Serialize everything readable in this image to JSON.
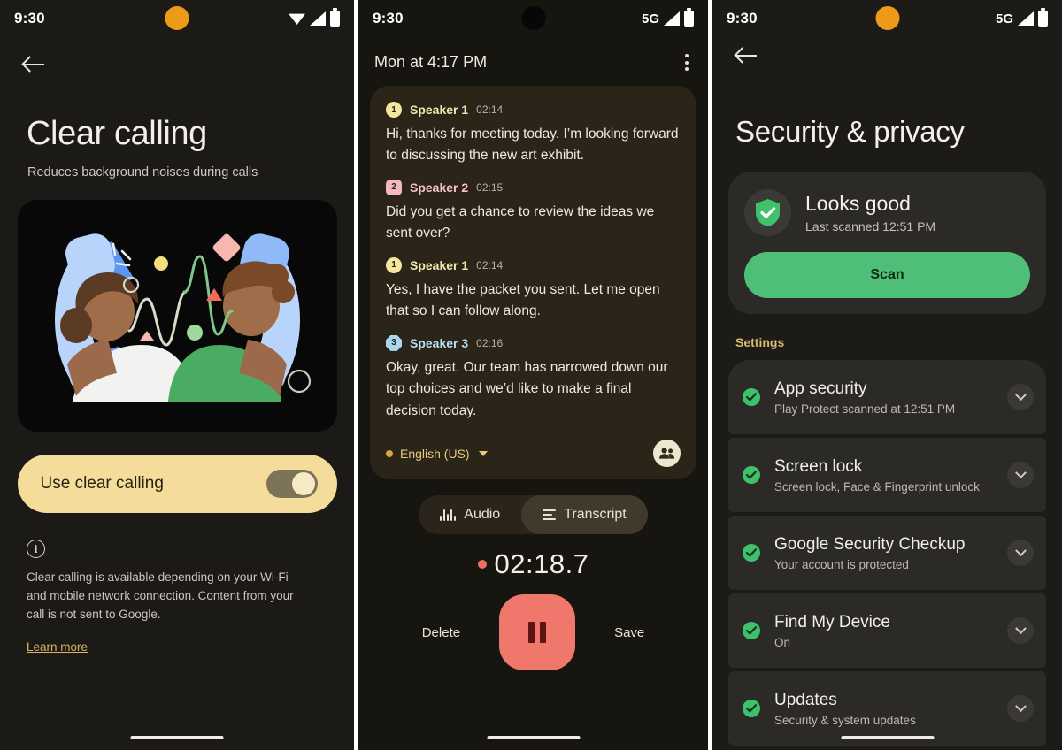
{
  "panel1": {
    "status": {
      "time": "9:30",
      "camera_color": "#ec9a17",
      "icons": [
        "wifi-icon",
        "signal-icon",
        "battery-icon"
      ]
    },
    "back_label": "back-arrow",
    "title": "Clear calling",
    "subtitle": "Reduces background noises during calls",
    "illustration_name": "two-people-call-illustration",
    "toggle": {
      "label": "Use clear calling",
      "state": "on",
      "card_color": "#f4dd9b"
    },
    "info_glyph": "i",
    "note": "Clear calling is available depending on your Wi-Fi and mobile network connection. Content from your call is not sent to Google.",
    "learn_more": "Learn more"
  },
  "panel2": {
    "status": {
      "time": "9:30",
      "camera_color": "#070707",
      "network": "5G",
      "icons": [
        "signal-icon",
        "battery-icon"
      ]
    },
    "header": {
      "date": "Mon at 4:17 PM",
      "menu": "more-options"
    },
    "transcript": [
      {
        "badge": "1",
        "speaker": "Speaker 1",
        "time": "02:14",
        "text": "Hi, thanks for meeting today. I’m looking forward to discussing the new art exhibit."
      },
      {
        "badge": "2",
        "speaker": "Speaker 2",
        "time": "02:15",
        "text": "Did you get a chance to review the ideas we sent over?"
      },
      {
        "badge": "1",
        "speaker": "Speaker 1",
        "time": "02:14",
        "text": "Yes, I have the packet you sent. Let me open that so I can follow along."
      },
      {
        "badge": "3",
        "speaker": "Speaker 3",
        "time": "02:16",
        "text": "Okay, great. Our team has narrowed down our top choices and we’d like to make a final decision today."
      }
    ],
    "language": "English (US)",
    "people_button": "speaker-labels",
    "tabs": [
      {
        "label": "Audio",
        "icon": "waveform-icon",
        "active": false
      },
      {
        "label": "Transcript",
        "icon": "lines-icon",
        "active": true
      }
    ],
    "timer": "02:18.7",
    "controls": {
      "delete": "Delete",
      "save": "Save",
      "primary": "pause"
    }
  },
  "panel3": {
    "status": {
      "time": "9:30",
      "camera_color": "#ec9a17",
      "network": "5G",
      "icons": [
        "signal-icon",
        "battery-icon"
      ]
    },
    "title": "Security & privacy",
    "status_card": {
      "title": "Looks good",
      "subtitle": "Last scanned 12:51 PM",
      "button": "Scan",
      "button_color": "#4fbe78"
    },
    "section_label": "Settings",
    "items": [
      {
        "title": "App security",
        "subtitle": "Play Protect scanned at 12:51 PM"
      },
      {
        "title": "Screen lock",
        "subtitle": "Screen lock, Face & Fingerprint unlock"
      },
      {
        "title": "Google Security Checkup",
        "subtitle": "Your account is protected"
      },
      {
        "title": "Find My Device",
        "subtitle": "On"
      },
      {
        "title": "Updates",
        "subtitle": "Security & system updates"
      }
    ]
  }
}
